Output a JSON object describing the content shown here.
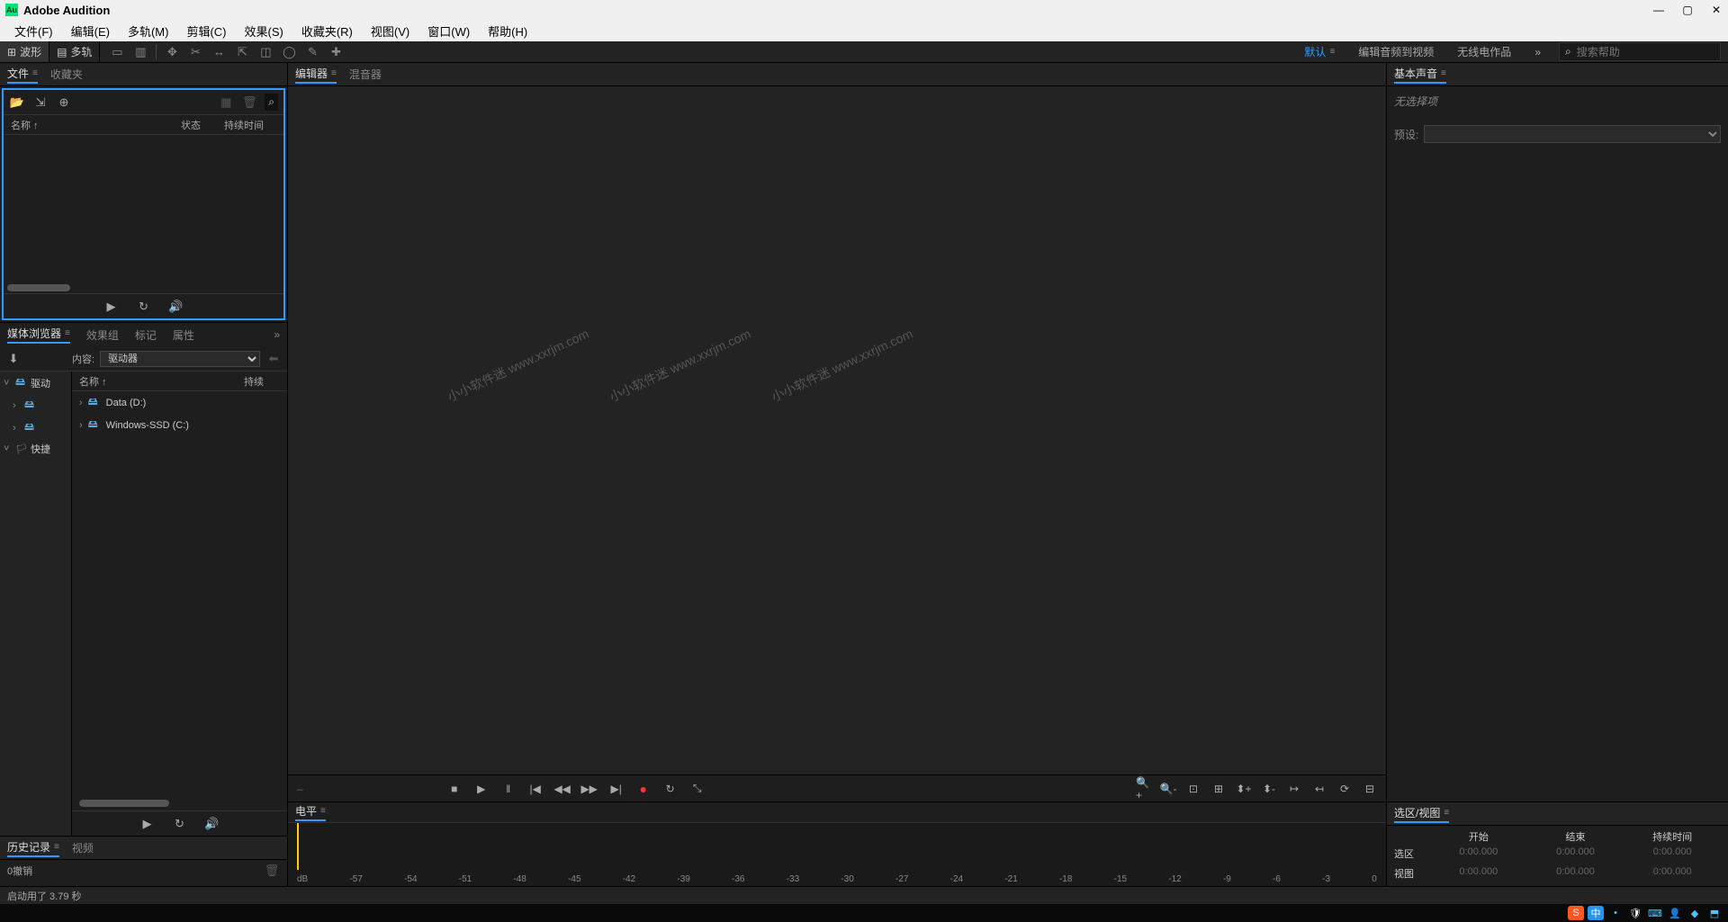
{
  "titlebar": {
    "app_name": "Adobe Audition"
  },
  "menubar": {
    "file": "文件(F)",
    "edit": "编辑(E)",
    "multitrack": "多轨(M)",
    "clip": "剪辑(C)",
    "effects": "效果(S)",
    "favorites": "收藏夹(R)",
    "view": "视图(V)",
    "window": "窗口(W)",
    "help": "帮助(H)"
  },
  "toolbar": {
    "waveform": "波形",
    "multitrack": "多轨",
    "ws_default": "默认",
    "ws_editaudio": "编辑音频到视频",
    "ws_radio": "无线电作品",
    "search_placeholder": "搜索帮助"
  },
  "files_panel": {
    "tab_files": "文件",
    "tab_fav": "收藏夹",
    "col_name": "名称 ↑",
    "col_status": "状态",
    "col_dur": "持续时间"
  },
  "media_panel": {
    "tab_media": "媒体浏览器",
    "tab_fxrack": "效果组",
    "tab_markers": "标记",
    "tab_props": "属性",
    "content_label": "内容:",
    "content_value": "驱动器",
    "list_col_name": "名称 ↑",
    "list_col_dur": "持续",
    "tree": {
      "drives": "驱动",
      "quick": "快捷",
      "d1": "Data (D:)",
      "d2": "Windows-SSD (C:)"
    },
    "drives": [
      "Data (D:)",
      "Windows-SSD (C:)"
    ]
  },
  "history_panel": {
    "tab_history": "历史记录",
    "tab_video": "视频",
    "undo": "0撤销"
  },
  "editor": {
    "tab_editor": "编辑器",
    "tab_mixer": "混音器"
  },
  "watermark": "小小软件迷 www.xxrjm.com",
  "levels": {
    "title": "电平",
    "db": "dB",
    "scale": [
      "-57",
      "-54",
      "-51",
      "-48",
      "-45",
      "-42",
      "-39",
      "-36",
      "-33",
      "-30",
      "-27",
      "-24",
      "-21",
      "-18",
      "-15",
      "-12",
      "-9",
      "-6",
      "-3",
      "0"
    ]
  },
  "essential": {
    "title": "基本声音",
    "no_selection": "无选择项",
    "preset": "预设:"
  },
  "selection": {
    "title": "选区/视图",
    "h_start": "开始",
    "h_end": "结束",
    "h_dur": "持续时间",
    "r_sel": "选区",
    "r_view": "视图",
    "zero": "0:00.000"
  },
  "statusbar": {
    "msg": "启动用了 3.79 秒"
  },
  "tray": {
    "ime": "中"
  }
}
